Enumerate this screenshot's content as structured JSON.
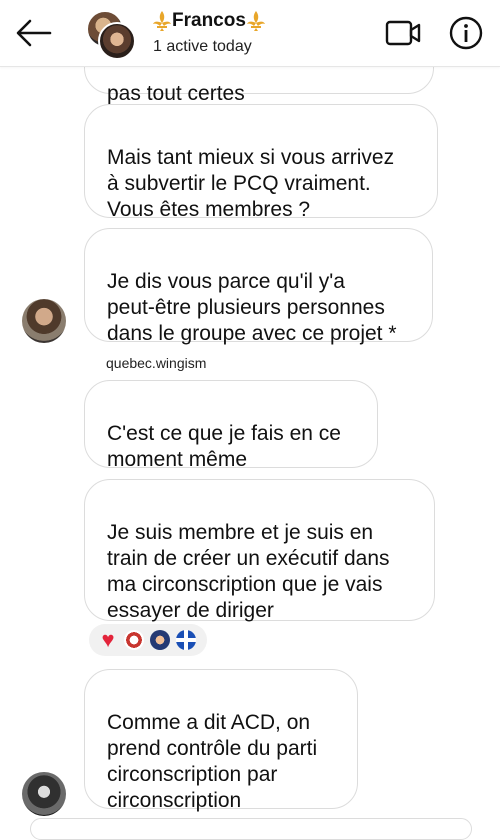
{
  "header": {
    "chat_name": "Francos",
    "status": "1 active today",
    "icons": [
      "back-arrow-icon",
      "fleur-de-lis-icon",
      "video-call-icon",
      "info-icon"
    ],
    "accent_gold": "#e8a62a"
  },
  "messages": {
    "m0": "pas tout certes",
    "m1": "Mais tant mieux si vous arrivez\nà subvertir le PCQ vraiment.\nVous êtes membres ?",
    "m2": "Je dis vous parce qu'il y'a\npeut-être plusieurs personnes\ndans le groupe avec ce projet *",
    "sender": "quebec.wingism",
    "m3": "C'est ce que je fais en ce\nmoment même",
    "m4": "Je suis membre et je suis en\ntrain de créer un exécutif dans\nma circonscription que je vais\nessayer de diriger",
    "m5": "Comme  a dit ACD, on\nprend contrôle du parti\ncirconscription par\ncirconscription"
  },
  "reactions": [
    "heart",
    "avatar",
    "avatar",
    "quebec-flag"
  ],
  "colors": {
    "bubble_border": "#dcdcdc",
    "heart": "#e3243b",
    "quebec_blue": "#1a4fb5"
  }
}
